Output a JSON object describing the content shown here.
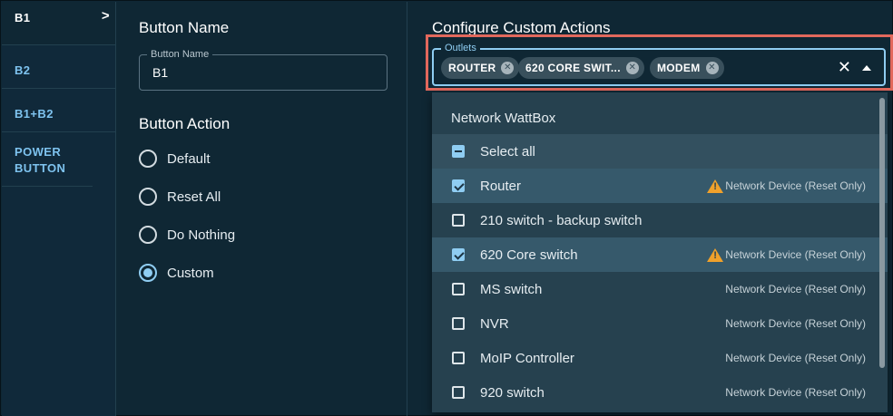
{
  "sidebar": {
    "items": [
      {
        "label": "B1",
        "active": true,
        "chevron": ">"
      },
      {
        "label": "B2"
      },
      {
        "label": "B1+B2"
      },
      {
        "label": "POWER BUTTON"
      }
    ]
  },
  "middle": {
    "section_title": "Button Name",
    "field_legend": "Button Name",
    "field_value": "B1",
    "action_title": "Button Action",
    "options": [
      {
        "label": "Default",
        "checked": false
      },
      {
        "label": "Reset All",
        "checked": false
      },
      {
        "label": "Do Nothing",
        "checked": false
      },
      {
        "label": "Custom",
        "checked": true
      }
    ]
  },
  "right": {
    "title": "Configure Custom Actions",
    "select_legend": "Outlets",
    "chips": [
      "ROUTER",
      "620 CORE SWIT...",
      "MODEM"
    ],
    "clear_icon": "close-icon",
    "caret_icon": "caret-up-icon",
    "menu": {
      "header": "Network WattBox",
      "select_all": "Select all",
      "items": [
        {
          "label": "Router",
          "checked": true,
          "warning": true,
          "tag": "Network Device (Reset Only)"
        },
        {
          "label": "210 switch - backup switch",
          "checked": false,
          "warning": false,
          "tag": ""
        },
        {
          "label": "620 Core switch",
          "checked": true,
          "warning": true,
          "tag": "Network Device (Reset Only)"
        },
        {
          "label": "MS switch",
          "checked": false,
          "warning": false,
          "tag": "Network Device (Reset Only)"
        },
        {
          "label": "NVR",
          "checked": false,
          "warning": false,
          "tag": "Network Device (Reset Only)"
        },
        {
          "label": "MoIP Controller",
          "checked": false,
          "warning": false,
          "tag": "Network Device (Reset Only)"
        },
        {
          "label": "920 switch",
          "checked": false,
          "warning": false,
          "tag": "Network Device (Reset Only)"
        }
      ]
    }
  },
  "colors": {
    "background": "#0f2734",
    "accent": "#8fcdf2",
    "highlight_outline": "#e2685c",
    "warning": "#f0a12b"
  }
}
